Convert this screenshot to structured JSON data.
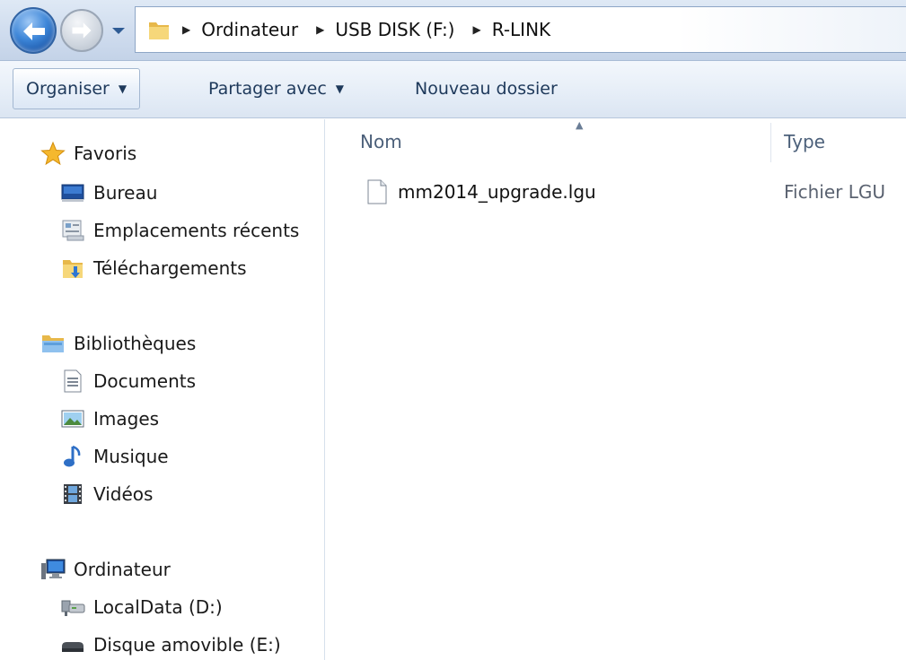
{
  "address_bar": {
    "breadcrumbs": [
      "Ordinateur",
      "USB DISK (F:)",
      "R-LINK"
    ]
  },
  "toolbar": {
    "organize_label": "Organiser",
    "share_label": "Partager avec",
    "new_folder_label": "Nouveau dossier"
  },
  "nav_pane": {
    "favorites": {
      "label": "Favoris",
      "items": [
        {
          "label": "Bureau",
          "icon": "desktop-icon"
        },
        {
          "label": "Emplacements récents",
          "icon": "recent-places-icon"
        },
        {
          "label": "Téléchargements",
          "icon": "downloads-folder-icon"
        }
      ]
    },
    "libraries": {
      "label": "Bibliothèques",
      "items": [
        {
          "label": "Documents",
          "icon": "document-icon"
        },
        {
          "label": "Images",
          "icon": "picture-icon"
        },
        {
          "label": "Musique",
          "icon": "music-note-icon"
        },
        {
          "label": "Vidéos",
          "icon": "film-icon"
        }
      ]
    },
    "computer": {
      "label": "Ordinateur",
      "items": [
        {
          "label": "LocalData (D:)",
          "icon": "network-drive-icon"
        },
        {
          "label": "Disque amovible (E:)",
          "icon": "removable-drive-icon"
        }
      ]
    }
  },
  "content": {
    "columns": {
      "name": "Nom",
      "type": "Type"
    },
    "files": [
      {
        "name": "mm2014_upgrade.lgu",
        "type": "Fichier LGU"
      }
    ]
  },
  "colors": {
    "accent": "#3d86d8",
    "toolbar_text": "#1e395b",
    "header_text": "#4c607a"
  }
}
